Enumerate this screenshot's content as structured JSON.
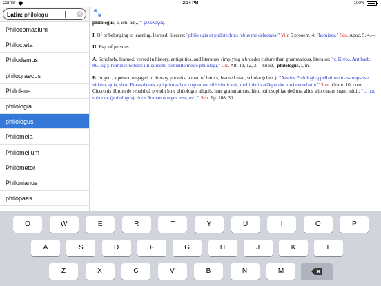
{
  "status_bar": {
    "carrier": "Carrier",
    "wifi_icon": "wifi-icon",
    "time": "2:34 PM",
    "battery_percent": "100%",
    "battery_level": 1.0
  },
  "search": {
    "label": "Latin:",
    "value": "philologu",
    "clear_icon": "clear-icon"
  },
  "word_list": [
    {
      "label": "Philocomasium"
    },
    {
      "label": "Philocteta"
    },
    {
      "label": "Philodemus"
    },
    {
      "label": "philograecus"
    },
    {
      "label": "Philolaus"
    },
    {
      "label": "philologia"
    },
    {
      "label": "philologus",
      "selected": true
    },
    {
      "label": "Philomela"
    },
    {
      "label": "Philomelium"
    },
    {
      "label": "Philometor"
    },
    {
      "label": "Philonianus"
    },
    {
      "label": "philopaes"
    },
    {
      "label": "Philopator"
    }
  ],
  "toolbar": {
    "expand_icon": "expand-icon"
  },
  "entry": {
    "headword": "phĭlŏlŏgus",
    "headword_rest": ", a, um, adj., = ",
    "greek": "φιλόλογος",
    "greek_end": ".",
    "sec1_num": "I.",
    "sec1_text": " Of or belonging to learning, learned, literary: ",
    "sec1_quote": "\"philologis et philotechnis rebus me delectans,\"",
    "sec1_ref": " Vitr.",
    "sec1_loc": " 6 prooem. 4: ",
    "sec1_quote2": "\"homines,\"",
    "sec1_ref2": " Sen.",
    "sec1_loc2": " Apoc. 5, 4.—",
    "sec2_num": "II.",
    "sec2_text": " Esp. of persons.",
    "secA_num": "A.",
    "secA_text": " Scholarly, learned, versed in history, antiquities, and literature (implying a broader culture than grammaticus, literator; ",
    "secA_quote": "\"v. Krebs, Antibarb. 863 sq.): homines nobiles illi quidem, sed nullo modo philologi,\"",
    "secA_ref": " Cic.",
    "secA_loc": " Att. 13, 12, 3.—Subst.: ",
    "secA_hw": "phĭlŏlŏgus",
    "secA_end": ", i, m. —",
    "secB_num": "B.",
    "secB_text": " In gen., a person engaged in literary pursuits, a man of letters, learned man, scholar (class.): ",
    "secB_quote": "\"Atteius Philologi appellationem assumpsisse videtur, quia, sicut Eratosthenes, qui primus hoc cognomen sibi vindicavit, multiplici variāque doctrinā censebatur,\"",
    "secB_ref": " Suet.",
    "secB_loc": " Gram. 10: cum Ciceronis librum de republicā prendit hinc philologus aliquis, hinc grammaticus, hinc philosophiae deditus, alius alio curam suam mittit; ",
    "secB_quote2": "\"... hoc subnotat (philologus): duos Romanos reges esse, etc.,\"",
    "secB_ref2": " Sen.",
    "secB_loc2": " Ep. 108, 30."
  },
  "keyboard": {
    "row1": [
      "Q",
      "W",
      "E",
      "R",
      "T",
      "Y",
      "U",
      "I",
      "O",
      "P"
    ],
    "row2": [
      "A",
      "S",
      "D",
      "F",
      "G",
      "H",
      "J",
      "K",
      "L"
    ],
    "row3": [
      "Z",
      "X",
      "C",
      "V",
      "B",
      "N",
      "M"
    ],
    "backspace_icon": "backspace-icon"
  }
}
